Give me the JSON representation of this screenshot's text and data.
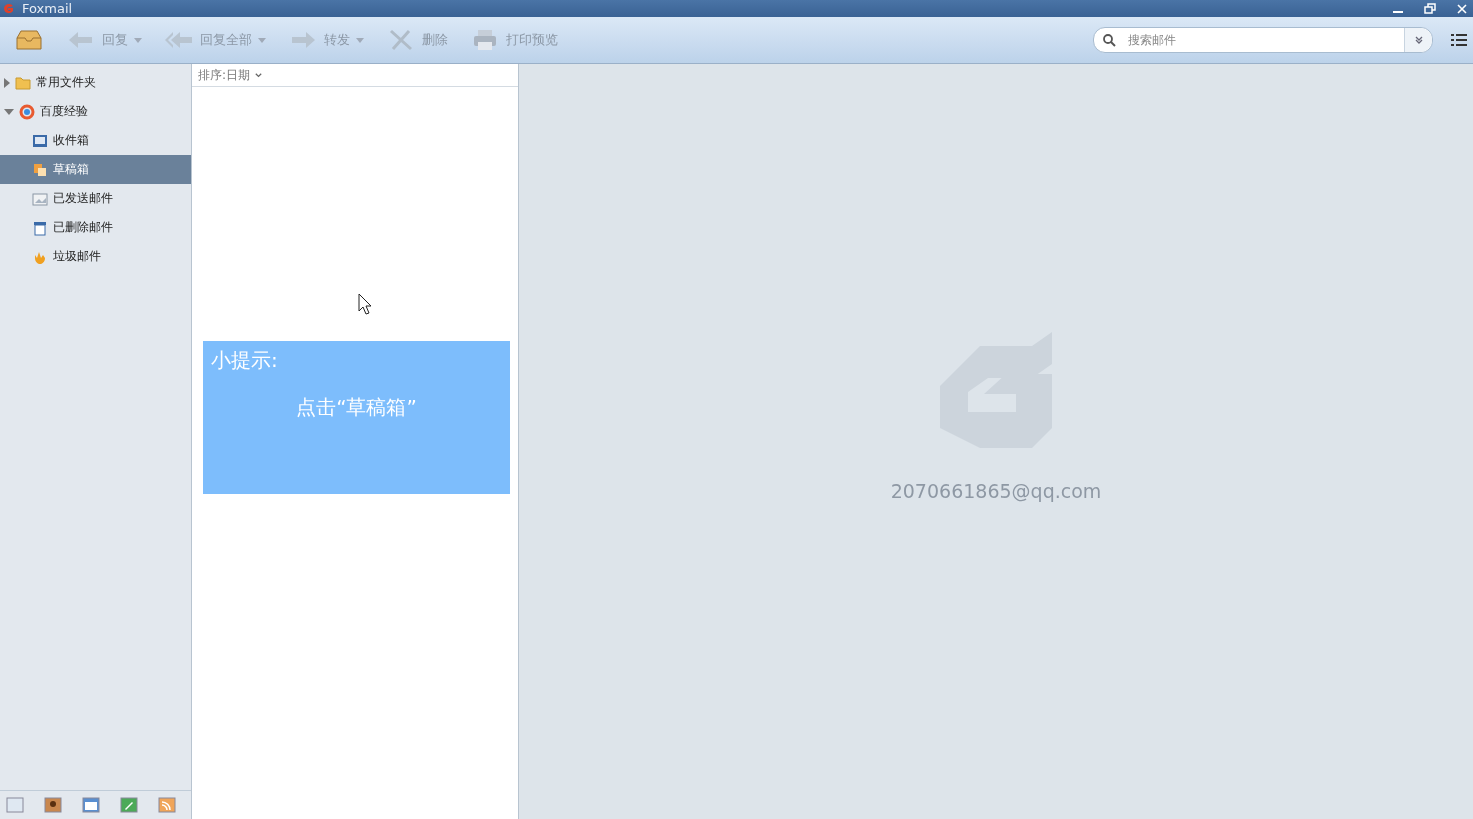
{
  "window": {
    "title": "Foxmail"
  },
  "toolbar": {
    "buttons": [
      {
        "kind": "inbox",
        "dropdown": false
      },
      {
        "kind": "reply",
        "label": "回复",
        "dropdown": true
      },
      {
        "kind": "reply_all",
        "label": "回复全部",
        "dropdown": true
      },
      {
        "kind": "forward",
        "label": "转发",
        "dropdown": true
      },
      {
        "kind": "delete",
        "label": "删除",
        "dropdown": false
      },
      {
        "kind": "print",
        "label": "打印预览",
        "dropdown": false
      }
    ],
    "search": {
      "placeholder": "搜索邮件"
    }
  },
  "sidebar": {
    "items": [
      {
        "label": "常用文件夹",
        "kind": "folder",
        "expanded": false,
        "selected": false
      },
      {
        "label": "百度经验",
        "kind": "account",
        "expanded": true,
        "selected": false,
        "children": [
          {
            "label": "收件箱",
            "kind": "inbox",
            "selected": false
          },
          {
            "label": "草稿箱",
            "kind": "drafts",
            "selected": true
          },
          {
            "label": "已发送邮件",
            "kind": "sent",
            "selected": false
          },
          {
            "label": "已删除邮件",
            "kind": "trash",
            "selected": false
          },
          {
            "label": "垃圾邮件",
            "kind": "junk",
            "selected": false
          }
        ]
      }
    ],
    "bottom_icons": [
      {
        "kind": "mail"
      },
      {
        "kind": "contacts"
      },
      {
        "kind": "calendar"
      },
      {
        "kind": "notes"
      },
      {
        "kind": "feeds"
      }
    ]
  },
  "message_list": {
    "sort": "排序:日期"
  },
  "tip": {
    "title": "小提示:",
    "text": "点击“草稿箱”"
  },
  "reading_pane": {
    "account": "2070661865@qq.com"
  }
}
